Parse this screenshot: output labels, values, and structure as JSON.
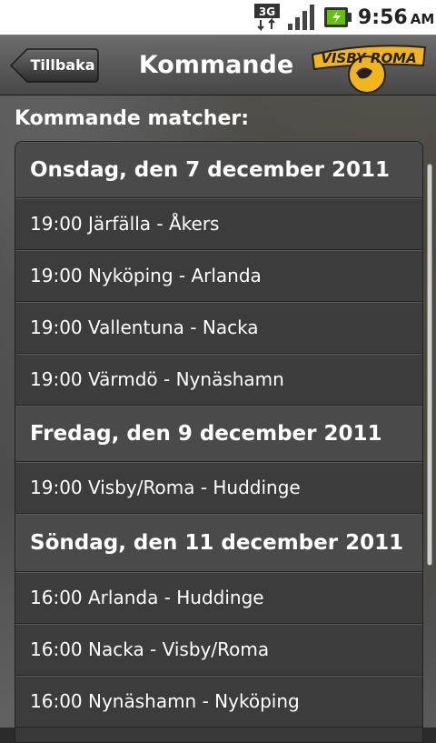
{
  "status_bar": {
    "network_label": "3G",
    "time": "9:56",
    "ampm": "AM",
    "icons": [
      "3g-data-icon",
      "signal-icon",
      "battery-charging-icon"
    ]
  },
  "title_bar": {
    "back_label": "Tillbaka",
    "title": "Kommande",
    "logo_text": "VISBY ROMA"
  },
  "main": {
    "section_label": "Kommande matcher:",
    "days": [
      {
        "date": "Onsdag, den 7 december 2011",
        "matches": [
          "19:00 Järfälla - Åkers",
          "19:00 Nyköping - Arlanda",
          "19:00 Vallentuna - Nacka",
          "19:00 Värmdö - Nynäshamn"
        ]
      },
      {
        "date": "Fredag, den 9 december 2011",
        "matches": [
          "19:00 Visby/Roma - Huddinge"
        ]
      },
      {
        "date": "Söndag, den 11 december 2011",
        "matches": [
          "16:00 Arlanda - Huddinge",
          "16:00 Nacka - Visby/Roma",
          "16:00 Nynäshamn - Nyköping"
        ]
      }
    ]
  },
  "colors": {
    "title_bar": "#5a5a5a",
    "row_bg": "#3c3c3c",
    "header_bg": "#4a4a4a",
    "logo_yellow": "#f2b51c"
  }
}
